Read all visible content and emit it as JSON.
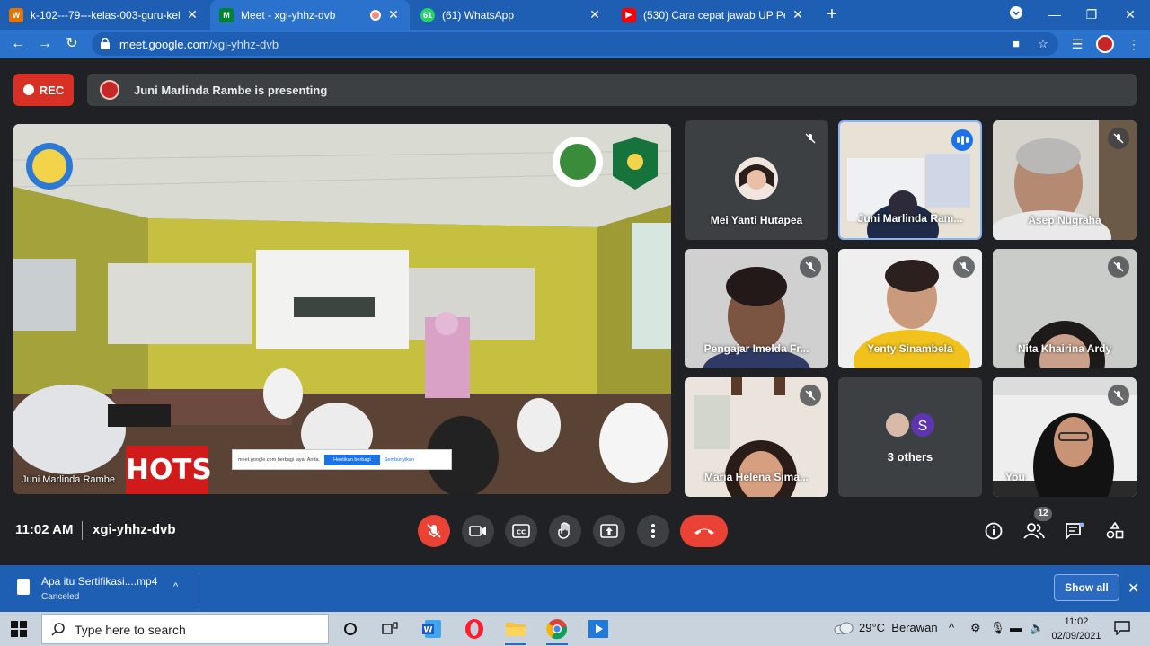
{
  "browser": {
    "tabs": [
      {
        "title": "k-102---79---kelas-003-guru-kel",
        "favicon": "wordpress-icon",
        "active": false
      },
      {
        "title": "Meet - xgi-yhhz-dvb",
        "favicon": "google-meet-icon",
        "active": true
      },
      {
        "title": "(61) WhatsApp",
        "favicon": "whatsapp-icon",
        "active": false
      },
      {
        "title": "(530) Cara cepat jawab UP Pedag",
        "favicon": "youtube-icon",
        "active": false
      }
    ],
    "new_tab": "+",
    "url_host": "meet.google.com",
    "url_path": "/xgi-yhhz-dvb"
  },
  "meet": {
    "rec_label": "REC",
    "presenting_text": "Juni Marlinda Rambe is presenting",
    "presenter_label": "Juni Marlinda Rambe",
    "overlay": {
      "hots_text": "HOTS",
      "share_text": "meet.google.com berbagi layar Anda.",
      "stop_label": "Hentikan berbagi",
      "hide_label": "Sembunyikan"
    },
    "participants": [
      {
        "name": "Mei Yanti Hutapea"
      },
      {
        "name": "Juni Marlinda Ram..."
      },
      {
        "name": "Asep Nugraha"
      },
      {
        "name": "Pengajar Imelda Fr..."
      },
      {
        "name": "Yenty Sinambela"
      },
      {
        "name": "Nita Khairina Ardy"
      },
      {
        "name": "Maria Helena Sima..."
      },
      {
        "name": "3 others",
        "initial": "S"
      },
      {
        "name": "You"
      }
    ],
    "time": "11:02 AM",
    "meeting_code": "xgi-yhhz-dvb",
    "people_count": "12"
  },
  "download": {
    "filename": "Apa itu Sertifikasi....mp4",
    "status": "Canceled",
    "show_all": "Show all"
  },
  "taskbar": {
    "search_placeholder": "Type here to search",
    "weather": "29°C  Berawan",
    "time": "11:02",
    "date": "02/09/2021"
  },
  "colors": {
    "browser_blue": "#2b72cd",
    "meet_bg": "#202124",
    "tile_bg": "#3c4043",
    "danger": "#ea4335",
    "speaking": "#1a73e8"
  }
}
